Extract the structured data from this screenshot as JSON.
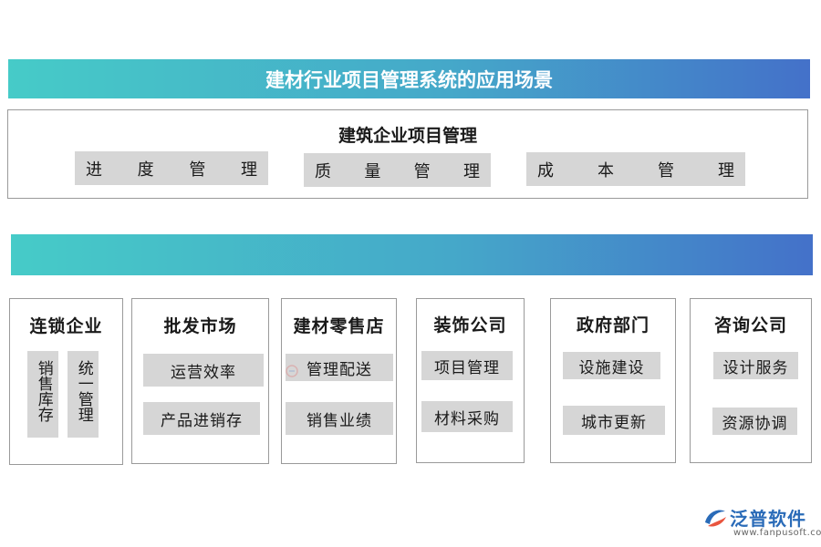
{
  "header": {
    "title": "建材行业项目管理系统的应用场景"
  },
  "construction": {
    "title": "建筑企业项目管理",
    "items": [
      {
        "label": "进度管理",
        "chars": [
          "进",
          "度",
          "管",
          "理"
        ]
      },
      {
        "label": "质量管理",
        "chars": [
          "质",
          "量",
          "管",
          "理"
        ]
      },
      {
        "label": "成本管理",
        "chars": [
          "成",
          "本",
          "管",
          "理"
        ]
      }
    ]
  },
  "middle_banner": {
    "title": ""
  },
  "scenarios": [
    {
      "title": "连锁企业",
      "items": [
        "销售库存",
        "统一管理"
      ]
    },
    {
      "title": "批发市场",
      "items": [
        "运营效率",
        "产品进销存"
      ]
    },
    {
      "title": "建材零售店",
      "items": [
        "管理配送",
        "销售业绩"
      ]
    },
    {
      "title": "装饰公司",
      "items": [
        "项目管理",
        "材料采购"
      ]
    },
    {
      "title": "政府部门",
      "items": [
        "设施建设",
        "城市更新"
      ]
    },
    {
      "title": "咨询公司",
      "items": [
        "设计服务",
        "资源协调"
      ]
    }
  ],
  "logo": {
    "name": "泛普软件",
    "url": "www.fanpusoft.com",
    "icon": "fanpu-logo-icon"
  },
  "colors": {
    "banner_start": "#46cbc8",
    "banner_end": "#4471c9",
    "chip": "#d6d6d6",
    "logo": "#2a6bb8"
  }
}
